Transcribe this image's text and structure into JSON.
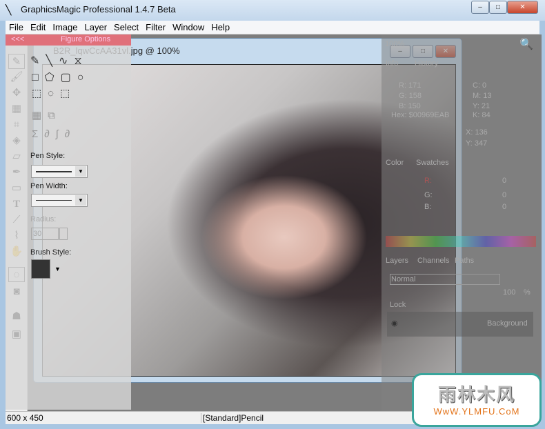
{
  "window": {
    "title": "GraphicsMagic Professional 1.4.7 Beta",
    "min": "–",
    "max": "□",
    "close": "✕"
  },
  "menu": [
    "File",
    "Edit",
    "Image",
    "Layer",
    "Select",
    "Filter",
    "Window",
    "Help"
  ],
  "figure_options": {
    "collapse": "<<<",
    "title": "Figure Options",
    "pen_style_label": "Pen Style:",
    "pen_width_label": "Pen Width:",
    "radius_label": "Radius:",
    "radius_value": "30",
    "brush_style_label": "Brush Style:"
  },
  "image_window": {
    "title": "B2R_lqwCcAA31vl.jpg @ 100%"
  },
  "right_panel": {
    "zoom": "100%",
    "tabs_info": [
      "Info",
      "History"
    ],
    "rgb": [
      "R: 171",
      "G: 158",
      "B: 150"
    ],
    "hex": "Hex: $00969EAB",
    "cmyk": [
      "C: 0",
      "M: 13",
      "Y: 21",
      "K: 84"
    ],
    "xy": [
      "X: 136",
      "Y: 347"
    ],
    "tabs_color": [
      "Color",
      "Swatches"
    ],
    "channels": [
      {
        "label": "R:",
        "value": "0"
      },
      {
        "label": "G:",
        "value": "0"
      },
      {
        "label": "B:",
        "value": "0"
      }
    ],
    "tabs_layers": [
      "Layers",
      "Channels",
      "Paths"
    ],
    "blend": "Normal",
    "opacity": "100",
    "percent": "%",
    "lock": "Lock",
    "layer_name": "Background"
  },
  "status": {
    "size": "600 x 450",
    "tool": "[Standard]Pencil"
  },
  "watermark": {
    "text": "雨林木风",
    "url": "WwW.YLMFU.CoM"
  }
}
